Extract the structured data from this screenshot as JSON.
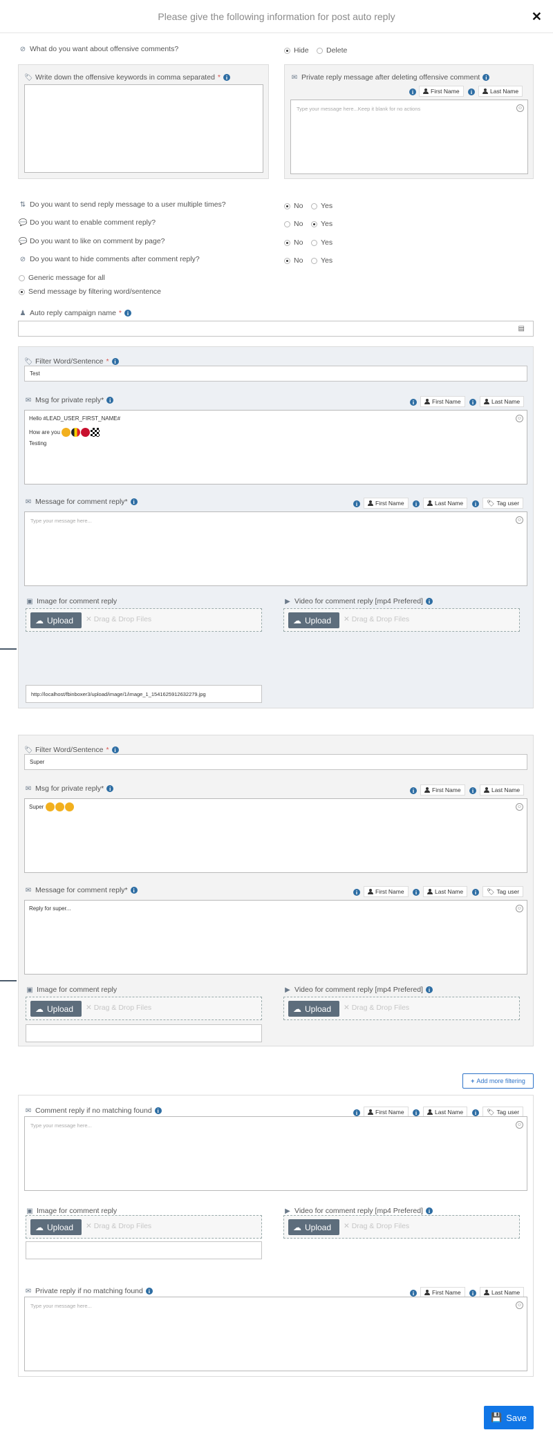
{
  "modal": {
    "title": "Please give the following information for post auto reply",
    "close_icon": "close-icon"
  },
  "offensive": {
    "question": "What do you want about offensive comments?",
    "options": [
      "Hide",
      "Delete"
    ],
    "selected": "Hide",
    "keywords_label": "Write down the offensive keywords in comma separated",
    "private_label": "Private reply message after deleting offensive comment",
    "private_placeholder": "Type your message here...Keep it blank for no actions"
  },
  "tokens": {
    "first_name": "First Name",
    "last_name": "Last Name",
    "tag_user": "Tag user"
  },
  "questions": [
    {
      "label": "Do you want to send reply message to a user multiple times?",
      "no": "No",
      "yes": "Yes",
      "selected": "No"
    },
    {
      "label": "Do you want to enable comment reply?",
      "no": "No",
      "yes": "Yes",
      "selected": "Yes"
    },
    {
      "label": "Do you want to like on comment by page?",
      "no": "No",
      "yes": "Yes",
      "selected": "No"
    },
    {
      "label": "Do you want to hide comments after comment reply?",
      "no": "No",
      "yes": "Yes",
      "selected": "No"
    }
  ],
  "mode": {
    "generic": "Generic message for all",
    "filter": "Send message by filtering word/sentence",
    "selected": "filter"
  },
  "campaign": {
    "label": "Auto reply campaign name",
    "value": ""
  },
  "filters": [
    {
      "word_label": "Filter Word/Sentence",
      "word_value": "Test",
      "private_label": "Msg for private reply*",
      "private_lines": [
        "Hello  #LEAD_USER_FIRST_NAME#",
        "How are you",
        "Testing"
      ],
      "comment_label": "Message for comment reply*",
      "comment_placeholder": "Type your message here...",
      "comment_value": "",
      "image_label": "Image for comment reply",
      "video_label": "Video for comment reply [mp4 Prefered]",
      "upload": "Upload",
      "dnd": "Drag & Drop Files",
      "image_url": "http://localhost/fbinboxer3/upload/image/1/image_1_1541625912632279.jpg"
    },
    {
      "word_label": "Filter Word/Sentence",
      "word_value": "Super",
      "private_label": "Msg for private reply*",
      "private_lines": [
        "Super"
      ],
      "comment_label": "Message for comment reply*",
      "comment_placeholder": "",
      "comment_value": "Reply for super...",
      "image_label": "Image for comment reply",
      "video_label": "Video for comment reply [mp4 Prefered]",
      "upload": "Upload",
      "dnd": "Drag & Drop Files",
      "image_url": ""
    }
  ],
  "add_more": "Add more filtering",
  "nomatch": {
    "comment_label": "Comment reply if no matching found",
    "comment_placeholder": "Type your message here...",
    "image_label": "Image for comment reply",
    "video_label": "Video for comment reply [mp4 Prefered]",
    "upload": "Upload",
    "dnd": "Drag & Drop Files",
    "private_label": "Private reply if no matching found",
    "private_placeholder": "Type your message here..."
  },
  "save": "Save"
}
